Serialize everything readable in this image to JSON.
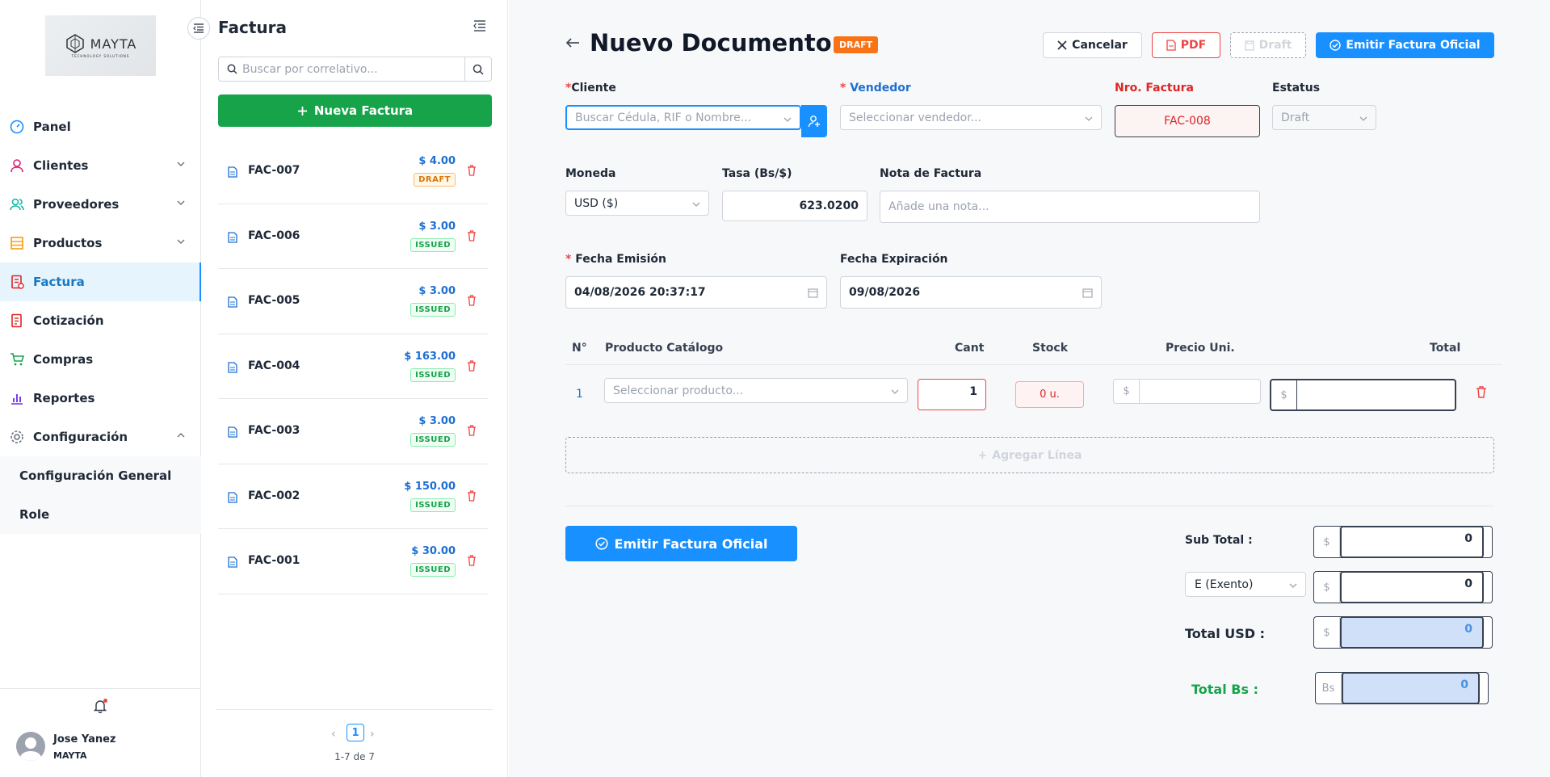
{
  "brand": {
    "name": "MAYTA",
    "tagline": "TECHNOLOGY SOLUTIONS"
  },
  "sidebar": {
    "items": [
      {
        "label": "Panel",
        "icon": "dashboard-icon",
        "expandable": false
      },
      {
        "label": "Clientes",
        "icon": "user-icon",
        "expandable": true
      },
      {
        "label": "Proveedores",
        "icon": "users-icon",
        "expandable": true
      },
      {
        "label": "Productos",
        "icon": "list-icon",
        "expandable": true
      },
      {
        "label": "Factura",
        "icon": "invoice-icon",
        "active": true
      },
      {
        "label": "Cotización",
        "icon": "quote-icon"
      },
      {
        "label": "Compras",
        "icon": "cart-icon"
      },
      {
        "label": "Reportes",
        "icon": "chart-icon"
      },
      {
        "label": "Configuración",
        "icon": "gear-icon",
        "expanded": true
      }
    ],
    "subitems": [
      {
        "label": "Configuración General"
      },
      {
        "label": "Role"
      }
    ],
    "user": {
      "name": "Jose Yanez",
      "org": "MAYTA"
    }
  },
  "list": {
    "title": "Factura",
    "search_placeholder": "Buscar por correlativo...",
    "new_label": "Nueva Factura",
    "invoices": [
      {
        "code": "FAC-007",
        "amount": "$ 4.00",
        "status": "DRAFT"
      },
      {
        "code": "FAC-006",
        "amount": "$ 3.00",
        "status": "ISSUED"
      },
      {
        "code": "FAC-005",
        "amount": "$ 3.00",
        "status": "ISSUED"
      },
      {
        "code": "FAC-004",
        "amount": "$ 163.00",
        "status": "ISSUED"
      },
      {
        "code": "FAC-003",
        "amount": "$ 3.00",
        "status": "ISSUED"
      },
      {
        "code": "FAC-002",
        "amount": "$ 150.00",
        "status": "ISSUED"
      },
      {
        "code": "FAC-001",
        "amount": "$ 30.00",
        "status": "ISSUED"
      }
    ],
    "page": "1",
    "range": "1-7 de 7"
  },
  "doc": {
    "title": "Nuevo Documento",
    "tag": "DRAFT",
    "buttons": {
      "cancel": "Cancelar",
      "pdf": "PDF",
      "draft": "Draft",
      "emit": "Emitir Factura Oficial"
    },
    "cliente": {
      "label": "Cliente",
      "placeholder": "Buscar Cédula, RIF o Nombre..."
    },
    "vendedor": {
      "label": "Vendedor",
      "placeholder": "Seleccionar vendedor..."
    },
    "nro": {
      "label": "Nro. Factura",
      "value": "FAC-008"
    },
    "estatus": {
      "label": "Estatus",
      "value": "Draft"
    },
    "moneda": {
      "label": "Moneda",
      "value": "USD ($)"
    },
    "tasa": {
      "label": "Tasa (Bs/$)",
      "value": "623.0200"
    },
    "nota": {
      "label": "Nota de Factura",
      "placeholder": "Añade una nota..."
    },
    "fecha_emision": {
      "label": "Fecha Emisión",
      "value": "04/08/2026 20:37:17"
    },
    "fecha_expiracion": {
      "label": "Fecha Expiración",
      "value": "09/08/2026"
    },
    "lines": {
      "headers": {
        "no": "N°",
        "product": "Producto Catálogo",
        "qty": "Cant",
        "stock": "Stock",
        "price": "Precio Uni.",
        "total": "Total"
      },
      "rows": [
        {
          "no": "1",
          "product_placeholder": "Seleccionar producto...",
          "qty": "1",
          "stock": "0 u.",
          "price_prefix": "$",
          "total_prefix": "$"
        }
      ],
      "add_label": "Agregar Línea"
    },
    "totals": {
      "subtotal_label": "Sub Total :",
      "subtotal": "0",
      "tax_option": "E (Exento)",
      "tax": "0",
      "total_usd_label": "Total USD :",
      "total_usd": "0",
      "total_bs_label": "Total Bs :",
      "total_bs": "0",
      "usd_prefix": "$",
      "bs_prefix": "Bs"
    }
  },
  "colors": {
    "accent": "#1890ff",
    "success": "#16a34a",
    "danger": "#ef4444",
    "draft": "#f97316"
  }
}
